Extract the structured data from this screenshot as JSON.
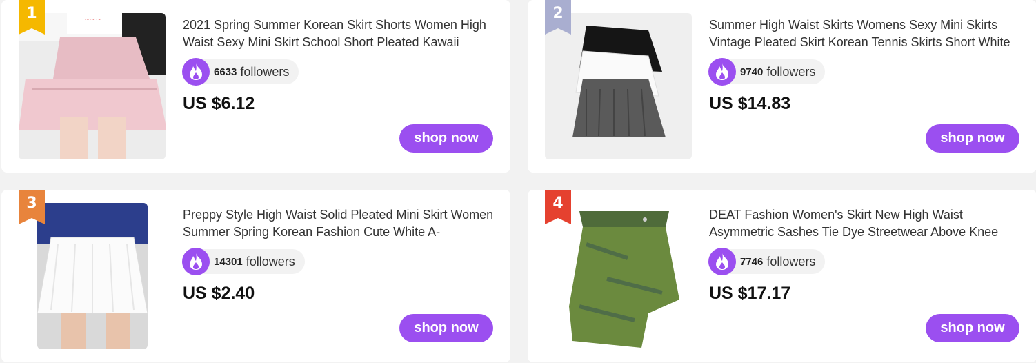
{
  "products": [
    {
      "rank": "1",
      "rank_color": "#f5b800",
      "title": "2021 Spring Summer Korean Skirt Shorts Women High Waist Sexy Mini Skirt School Short Pleated Kawaii",
      "followers_count": "6633",
      "followers_label": "followers",
      "price": "US $6.12",
      "button_label": "shop now"
    },
    {
      "rank": "2",
      "rank_color": "#a9aed0",
      "title": "Summer High Waist Skirts Womens Sexy Mini Skirts Vintage Pleated Skirt Korean Tennis Skirts Short White",
      "followers_count": "9740",
      "followers_label": "followers",
      "price": "US $14.83",
      "button_label": "shop now"
    },
    {
      "rank": "3",
      "rank_color": "#e8843c",
      "title": "Preppy Style High Waist Solid Pleated Mini Skirt Women Summer Spring Korean Fashion Cute White A-",
      "followers_count": "14301",
      "followers_label": "followers",
      "price": "US $2.40",
      "button_label": "shop now"
    },
    {
      "rank": "4",
      "rank_color": "#e5412f",
      "title": "DEAT Fashion Women's Skirt New High Waist Asymmetric Sashes Tie Dye Streetwear Above Knee",
      "followers_count": "7746",
      "followers_label": "followers",
      "price": "US $17.17",
      "button_label": "shop now"
    }
  ],
  "accent_color": "#9b4ff0",
  "icon": "fire-icon"
}
